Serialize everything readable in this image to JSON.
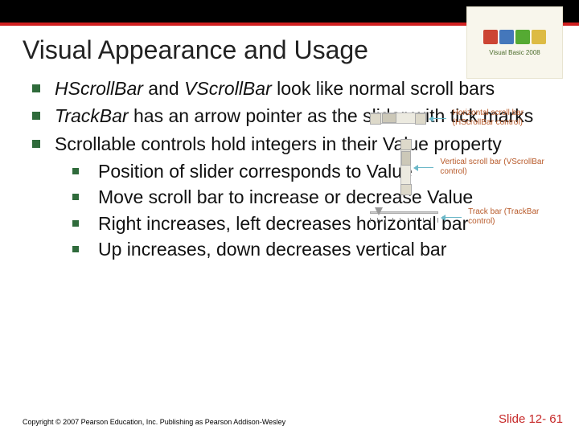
{
  "title": "Visual Appearance and Usage",
  "logo": {
    "text": "Visual Basic 2008"
  },
  "bullets": {
    "b1_em1": "HScrollBar",
    "b1_mid": " and ",
    "b1_em2": "VScrollBar",
    "b1_rest": " look like normal scroll bars",
    "b2_em": "TrackBar",
    "b2_rest": " has an arrow pointer as the slider with tick marks",
    "b3": "Scrollable controls hold integers in their Value property",
    "sub1": "Position of slider corresponds to Value",
    "sub2": "Move scroll bar to increase or decrease Value",
    "sub3": "Right increases, left decreases horizontal bar",
    "sub4": "Up increases, down decreases vertical bar"
  },
  "diagram": {
    "hscroll_label": "Horizontal scroll bar (HScrollBar control)",
    "vscroll_label": "Vertical scroll bar (VScrollBar control)",
    "trackbar_label": "Track bar (TrackBar control)"
  },
  "footer": {
    "copyright": "Copyright © 2007 Pearson Education, Inc. Publishing as Pearson Addison-Wesley",
    "slidenum": "Slide 12- 61"
  }
}
